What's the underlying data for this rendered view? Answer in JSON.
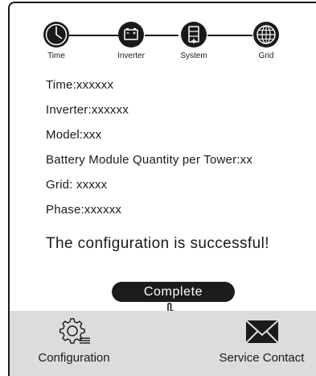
{
  "stepper": {
    "steps": [
      {
        "label": "Time",
        "icon": "clock-icon"
      },
      {
        "label": "Inverter",
        "icon": "battery-icon"
      },
      {
        "label": "System",
        "icon": "system-icon"
      },
      {
        "label": "Grid",
        "icon": "globe-icon"
      }
    ]
  },
  "info": {
    "time": "Time:xxxxxx",
    "inverter": "Inverter:xxxxxx",
    "model": "Model:xxx",
    "battery_modules": "Battery Module Quantity per Tower:xx",
    "grid": "Grid: xxxxx",
    "phase": "Phase:xxxxxx"
  },
  "message": "The configuration is successful!",
  "complete_button": "Complete",
  "bottom_nav": {
    "configuration": {
      "label": "Configuration",
      "icon": "gear-settings-icon"
    },
    "service_contact": {
      "label": "Service Contact",
      "icon": "envelope-icon"
    }
  },
  "colors": {
    "accent": "#1c1c1c",
    "bottom_bar": "#dcdcdc",
    "background": "#ffffff"
  }
}
